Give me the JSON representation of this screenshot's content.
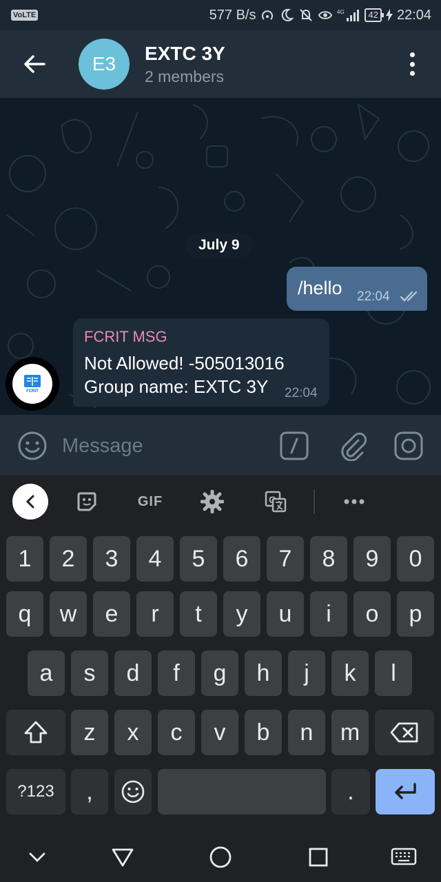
{
  "status_bar": {
    "carrier_badge": "VoLTE",
    "net_speed": "577 B/s",
    "network_type": "4G",
    "battery": "42",
    "time": "22:04",
    "icons": [
      "hotspot-icon",
      "moon-icon",
      "mute-icon",
      "eye-icon",
      "signal-icon",
      "battery-icon",
      "charging-icon"
    ]
  },
  "header": {
    "avatar_initials": "E3",
    "avatar_color": "#6cc0d9",
    "title": "EXTC 3Y",
    "subtitle": "2 members"
  },
  "chat": {
    "date_label": "July 9",
    "outgoing": {
      "text": "/hello",
      "time": "22:04",
      "status": "read"
    },
    "incoming": {
      "sender": "FCRIT MSG",
      "sender_color": "#e98bb1",
      "line1": "Not Allowed! -505013016",
      "line2": "Group name: EXTC 3Y",
      "time": "22:04",
      "avatar_label": "FCRIT"
    }
  },
  "input": {
    "placeholder": "Message",
    "value": ""
  },
  "keyboard": {
    "toolbar_gif": "GIF",
    "number_row": [
      "1",
      "2",
      "3",
      "4",
      "5",
      "6",
      "7",
      "8",
      "9",
      "0"
    ],
    "row1": [
      "q",
      "w",
      "e",
      "r",
      "t",
      "y",
      "u",
      "i",
      "o",
      "p"
    ],
    "row2": [
      "a",
      "s",
      "d",
      "f",
      "g",
      "h",
      "j",
      "k",
      "l"
    ],
    "row3": [
      "z",
      "x",
      "c",
      "v",
      "b",
      "n",
      "m"
    ],
    "symbols_key": "?123",
    "comma_key": ",",
    "period_key": ".",
    "accent_color": "#8ab4f8"
  },
  "nav_bar": {
    "icons": [
      "hide-keyboard-icon",
      "back-icon",
      "home-icon",
      "recents-icon",
      "keyboard-icon"
    ]
  }
}
